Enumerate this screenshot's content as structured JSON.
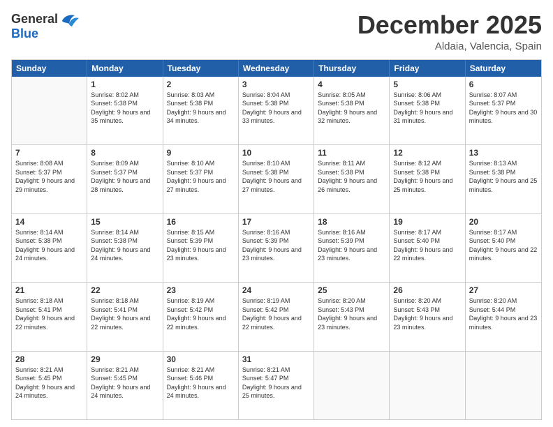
{
  "header": {
    "logo_general": "General",
    "logo_blue": "Blue",
    "month_title": "December 2025",
    "location": "Aldaia, Valencia, Spain"
  },
  "calendar": {
    "days_of_week": [
      "Sunday",
      "Monday",
      "Tuesday",
      "Wednesday",
      "Thursday",
      "Friday",
      "Saturday"
    ],
    "weeks": [
      [
        {
          "day": "",
          "empty": true,
          "sunrise": "",
          "sunset": "",
          "daylight": ""
        },
        {
          "day": "1",
          "empty": false,
          "sunrise": "Sunrise: 8:02 AM",
          "sunset": "Sunset: 5:38 PM",
          "daylight": "Daylight: 9 hours and 35 minutes."
        },
        {
          "day": "2",
          "empty": false,
          "sunrise": "Sunrise: 8:03 AM",
          "sunset": "Sunset: 5:38 PM",
          "daylight": "Daylight: 9 hours and 34 minutes."
        },
        {
          "day": "3",
          "empty": false,
          "sunrise": "Sunrise: 8:04 AM",
          "sunset": "Sunset: 5:38 PM",
          "daylight": "Daylight: 9 hours and 33 minutes."
        },
        {
          "day": "4",
          "empty": false,
          "sunrise": "Sunrise: 8:05 AM",
          "sunset": "Sunset: 5:38 PM",
          "daylight": "Daylight: 9 hours and 32 minutes."
        },
        {
          "day": "5",
          "empty": false,
          "sunrise": "Sunrise: 8:06 AM",
          "sunset": "Sunset: 5:38 PM",
          "daylight": "Daylight: 9 hours and 31 minutes."
        },
        {
          "day": "6",
          "empty": false,
          "sunrise": "Sunrise: 8:07 AM",
          "sunset": "Sunset: 5:37 PM",
          "daylight": "Daylight: 9 hours and 30 minutes."
        }
      ],
      [
        {
          "day": "7",
          "empty": false,
          "sunrise": "Sunrise: 8:08 AM",
          "sunset": "Sunset: 5:37 PM",
          "daylight": "Daylight: 9 hours and 29 minutes."
        },
        {
          "day": "8",
          "empty": false,
          "sunrise": "Sunrise: 8:09 AM",
          "sunset": "Sunset: 5:37 PM",
          "daylight": "Daylight: 9 hours and 28 minutes."
        },
        {
          "day": "9",
          "empty": false,
          "sunrise": "Sunrise: 8:10 AM",
          "sunset": "Sunset: 5:37 PM",
          "daylight": "Daylight: 9 hours and 27 minutes."
        },
        {
          "day": "10",
          "empty": false,
          "sunrise": "Sunrise: 8:10 AM",
          "sunset": "Sunset: 5:38 PM",
          "daylight": "Daylight: 9 hours and 27 minutes."
        },
        {
          "day": "11",
          "empty": false,
          "sunrise": "Sunrise: 8:11 AM",
          "sunset": "Sunset: 5:38 PM",
          "daylight": "Daylight: 9 hours and 26 minutes."
        },
        {
          "day": "12",
          "empty": false,
          "sunrise": "Sunrise: 8:12 AM",
          "sunset": "Sunset: 5:38 PM",
          "daylight": "Daylight: 9 hours and 25 minutes."
        },
        {
          "day": "13",
          "empty": false,
          "sunrise": "Sunrise: 8:13 AM",
          "sunset": "Sunset: 5:38 PM",
          "daylight": "Daylight: 9 hours and 25 minutes."
        }
      ],
      [
        {
          "day": "14",
          "empty": false,
          "sunrise": "Sunrise: 8:14 AM",
          "sunset": "Sunset: 5:38 PM",
          "daylight": "Daylight: 9 hours and 24 minutes."
        },
        {
          "day": "15",
          "empty": false,
          "sunrise": "Sunrise: 8:14 AM",
          "sunset": "Sunset: 5:38 PM",
          "daylight": "Daylight: 9 hours and 24 minutes."
        },
        {
          "day": "16",
          "empty": false,
          "sunrise": "Sunrise: 8:15 AM",
          "sunset": "Sunset: 5:39 PM",
          "daylight": "Daylight: 9 hours and 23 minutes."
        },
        {
          "day": "17",
          "empty": false,
          "sunrise": "Sunrise: 8:16 AM",
          "sunset": "Sunset: 5:39 PM",
          "daylight": "Daylight: 9 hours and 23 minutes."
        },
        {
          "day": "18",
          "empty": false,
          "sunrise": "Sunrise: 8:16 AM",
          "sunset": "Sunset: 5:39 PM",
          "daylight": "Daylight: 9 hours and 23 minutes."
        },
        {
          "day": "19",
          "empty": false,
          "sunrise": "Sunrise: 8:17 AM",
          "sunset": "Sunset: 5:40 PM",
          "daylight": "Daylight: 9 hours and 22 minutes."
        },
        {
          "day": "20",
          "empty": false,
          "sunrise": "Sunrise: 8:17 AM",
          "sunset": "Sunset: 5:40 PM",
          "daylight": "Daylight: 9 hours and 22 minutes."
        }
      ],
      [
        {
          "day": "21",
          "empty": false,
          "sunrise": "Sunrise: 8:18 AM",
          "sunset": "Sunset: 5:41 PM",
          "daylight": "Daylight: 9 hours and 22 minutes."
        },
        {
          "day": "22",
          "empty": false,
          "sunrise": "Sunrise: 8:18 AM",
          "sunset": "Sunset: 5:41 PM",
          "daylight": "Daylight: 9 hours and 22 minutes."
        },
        {
          "day": "23",
          "empty": false,
          "sunrise": "Sunrise: 8:19 AM",
          "sunset": "Sunset: 5:42 PM",
          "daylight": "Daylight: 9 hours and 22 minutes."
        },
        {
          "day": "24",
          "empty": false,
          "sunrise": "Sunrise: 8:19 AM",
          "sunset": "Sunset: 5:42 PM",
          "daylight": "Daylight: 9 hours and 22 minutes."
        },
        {
          "day": "25",
          "empty": false,
          "sunrise": "Sunrise: 8:20 AM",
          "sunset": "Sunset: 5:43 PM",
          "daylight": "Daylight: 9 hours and 23 minutes."
        },
        {
          "day": "26",
          "empty": false,
          "sunrise": "Sunrise: 8:20 AM",
          "sunset": "Sunset: 5:43 PM",
          "daylight": "Daylight: 9 hours and 23 minutes."
        },
        {
          "day": "27",
          "empty": false,
          "sunrise": "Sunrise: 8:20 AM",
          "sunset": "Sunset: 5:44 PM",
          "daylight": "Daylight: 9 hours and 23 minutes."
        }
      ],
      [
        {
          "day": "28",
          "empty": false,
          "sunrise": "Sunrise: 8:21 AM",
          "sunset": "Sunset: 5:45 PM",
          "daylight": "Daylight: 9 hours and 24 minutes."
        },
        {
          "day": "29",
          "empty": false,
          "sunrise": "Sunrise: 8:21 AM",
          "sunset": "Sunset: 5:45 PM",
          "daylight": "Daylight: 9 hours and 24 minutes."
        },
        {
          "day": "30",
          "empty": false,
          "sunrise": "Sunrise: 8:21 AM",
          "sunset": "Sunset: 5:46 PM",
          "daylight": "Daylight: 9 hours and 24 minutes."
        },
        {
          "day": "31",
          "empty": false,
          "sunrise": "Sunrise: 8:21 AM",
          "sunset": "Sunset: 5:47 PM",
          "daylight": "Daylight: 9 hours and 25 minutes."
        },
        {
          "day": "",
          "empty": true,
          "sunrise": "",
          "sunset": "",
          "daylight": ""
        },
        {
          "day": "",
          "empty": true,
          "sunrise": "",
          "sunset": "",
          "daylight": ""
        },
        {
          "day": "",
          "empty": true,
          "sunrise": "",
          "sunset": "",
          "daylight": ""
        }
      ]
    ]
  }
}
